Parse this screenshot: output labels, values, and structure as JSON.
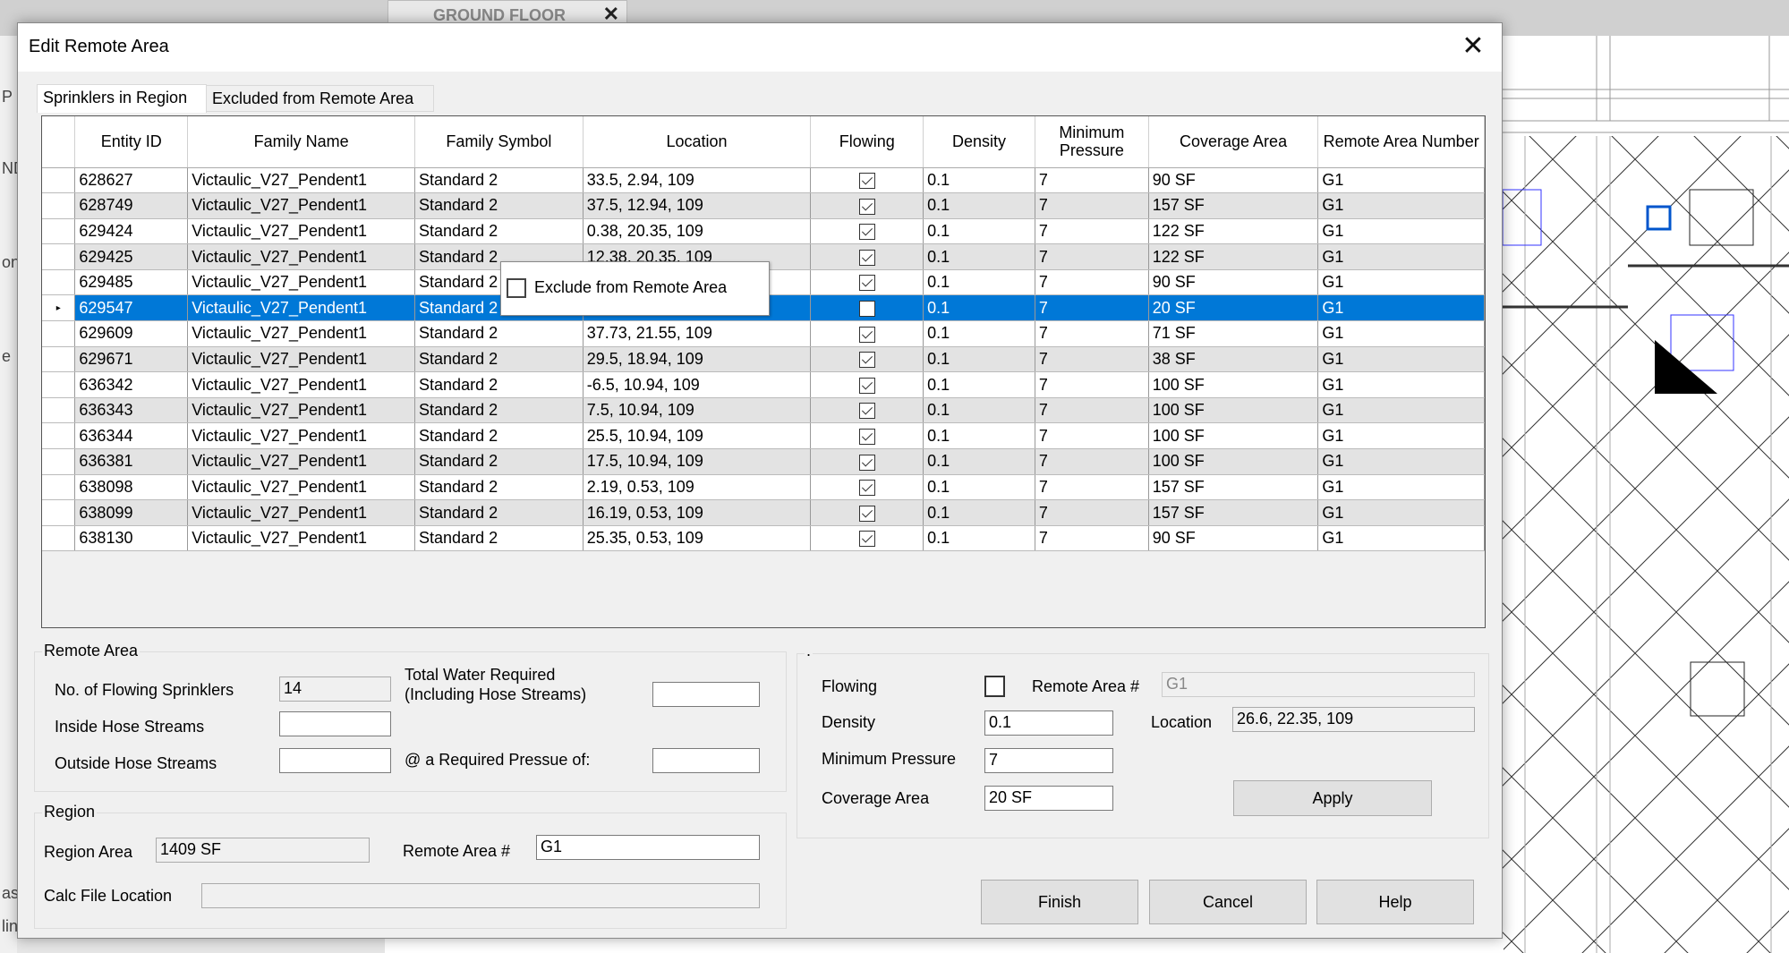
{
  "background": {
    "view_tab": "GROUND FLOOR",
    "left_fragments": [
      "P",
      "ND",
      "on",
      "e",
      "ass",
      "lin"
    ]
  },
  "dialog": {
    "title": "Edit Remote Area",
    "tabs": [
      {
        "label": "Sprinklers in Region",
        "active": true
      },
      {
        "label": "Excluded from Remote Area",
        "active": false
      }
    ],
    "grid": {
      "columns": [
        "Entity ID",
        "Family Name",
        "Family Symbol",
        "Location",
        "Flowing",
        "Density",
        "Minimum Pressure",
        "Coverage Area",
        "Remote Area Number"
      ],
      "selected_index": 5,
      "rows": [
        [
          "628627",
          "Victaulic_V27_Pendent1",
          "Standard 2",
          "33.5, 2.94, 109",
          true,
          "0.1",
          "7",
          "90 SF",
          "G1"
        ],
        [
          "628749",
          "Victaulic_V27_Pendent1",
          "Standard 2",
          "37.5, 12.94, 109",
          true,
          "0.1",
          "7",
          "157 SF",
          "G1"
        ],
        [
          "629424",
          "Victaulic_V27_Pendent1",
          "Standard 2",
          "0.38, 20.35, 109",
          true,
          "0.1",
          "7",
          "122 SF",
          "G1"
        ],
        [
          "629425",
          "Victaulic_V27_Pendent1",
          "Standard 2",
          "12.38, 20.35, 109",
          true,
          "0.1",
          "7",
          "122 SF",
          "G1"
        ],
        [
          "629485",
          "Victaulic_V27_Pendent1",
          "Standard 2",
          "",
          true,
          "0.1",
          "7",
          "90 SF",
          "G1"
        ],
        [
          "629547",
          "Victaulic_V27_Pendent1",
          "Standard 2",
          "",
          false,
          "0.1",
          "7",
          "20 SF",
          "G1"
        ],
        [
          "629609",
          "Victaulic_V27_Pendent1",
          "Standard 2",
          "37.73, 21.55, 109",
          true,
          "0.1",
          "7",
          "71 SF",
          "G1"
        ],
        [
          "629671",
          "Victaulic_V27_Pendent1",
          "Standard 2",
          "29.5, 18.94, 109",
          true,
          "0.1",
          "7",
          "38 SF",
          "G1"
        ],
        [
          "636342",
          "Victaulic_V27_Pendent1",
          "Standard 2",
          "-6.5, 10.94, 109",
          true,
          "0.1",
          "7",
          "100 SF",
          "G1"
        ],
        [
          "636343",
          "Victaulic_V27_Pendent1",
          "Standard 2",
          "7.5, 10.94, 109",
          true,
          "0.1",
          "7",
          "100 SF",
          "G1"
        ],
        [
          "636344",
          "Victaulic_V27_Pendent1",
          "Standard 2",
          "25.5, 10.94, 109",
          true,
          "0.1",
          "7",
          "100 SF",
          "G1"
        ],
        [
          "636381",
          "Victaulic_V27_Pendent1",
          "Standard 2",
          "17.5, 10.94, 109",
          true,
          "0.1",
          "7",
          "100 SF",
          "G1"
        ],
        [
          "638098",
          "Victaulic_V27_Pendent1",
          "Standard 2",
          "2.19, 0.53, 109",
          true,
          "0.1",
          "7",
          "157 SF",
          "G1"
        ],
        [
          "638099",
          "Victaulic_V27_Pendent1",
          "Standard 2",
          "16.19, 0.53, 109",
          true,
          "0.1",
          "7",
          "157 SF",
          "G1"
        ],
        [
          "638130",
          "Victaulic_V27_Pendent1",
          "Standard 2",
          "25.35, 0.53, 109",
          true,
          "0.1",
          "7",
          "90 SF",
          "G1"
        ]
      ]
    },
    "context_menu": {
      "label": "Exclude from Remote Area",
      "checked": false
    },
    "remote_area": {
      "group_label": "Remote Area",
      "flowing_sprinklers_label": "No. of Flowing Sprinklers",
      "flowing_sprinklers_value": "14",
      "total_water_label_1": "Total Water Required",
      "total_water_label_2": "(Including Hose Streams)",
      "total_water_value": "",
      "inside_hose_label": "Inside Hose Streams",
      "inside_hose_value": "",
      "outside_hose_label": "Outside Hose Streams",
      "outside_hose_value": "",
      "required_pressure_label": "@ a Required Pressue of:",
      "required_pressure_value": ""
    },
    "region": {
      "group_label": "Region",
      "area_label": "Region Area",
      "area_value": "1409 SF",
      "remote_area_label": "Remote Area #",
      "remote_area_value": "G1",
      "calc_file_label": "Calc File Location",
      "calc_file_value": ""
    },
    "sprinkler": {
      "group_label": ".",
      "flowing_label": "Flowing",
      "flowing_checked": false,
      "remote_area_label": "Remote Area #",
      "remote_area_value": "G1",
      "density_label": "Density",
      "density_value": "0.1",
      "location_label": "Location",
      "location_value": "26.6, 22.35, 109",
      "min_pressure_label": "Minimum Pressure",
      "min_pressure_value": "7",
      "coverage_label": "Coverage Area",
      "coverage_value": "20 SF",
      "apply_label": "Apply"
    },
    "buttons": {
      "finish": "Finish",
      "cancel": "Cancel",
      "help": "Help"
    },
    "colors": {
      "selection": "#0078d7",
      "alt_row": "#e3e3e3"
    }
  }
}
